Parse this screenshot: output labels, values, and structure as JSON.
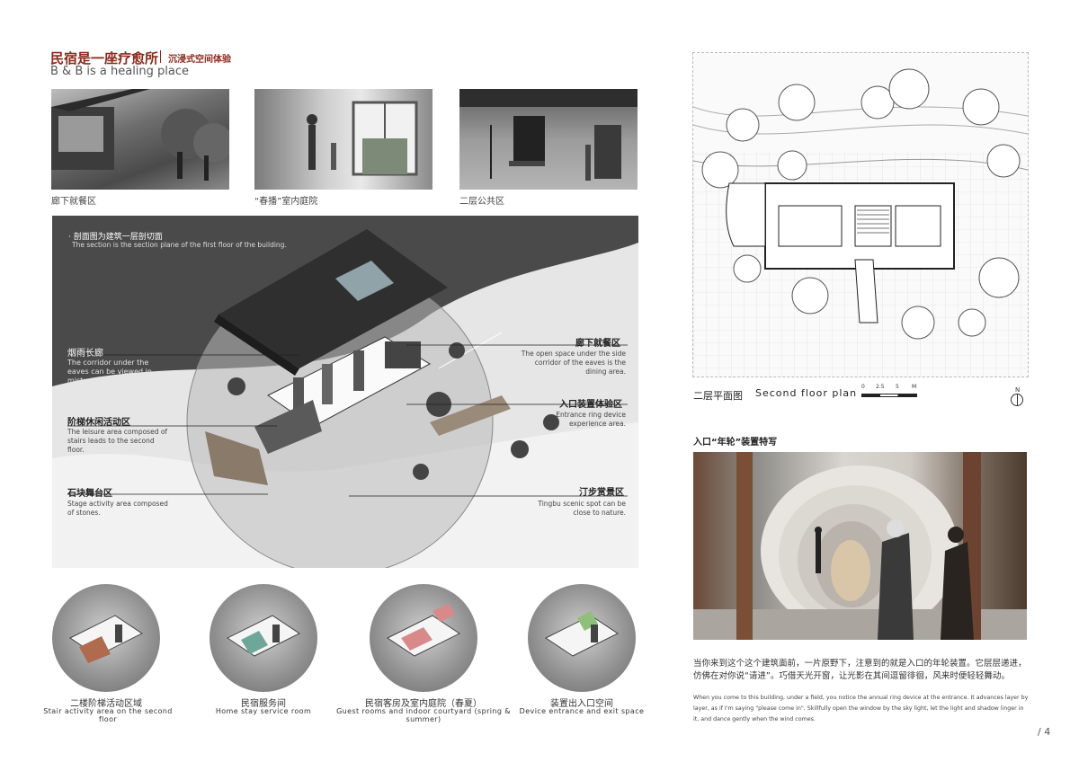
{
  "header": {
    "title_zh": "民宿是一座疗愈所",
    "subtitle_zh": "沉浸式空间体验",
    "title_en": "B & B is a healing place"
  },
  "photos": [
    {
      "caption": "廊下就餐区"
    },
    {
      "caption": "“春播”室内庭院"
    },
    {
      "caption": "二层公共区"
    }
  ],
  "section": {
    "note_zh": "· 剖面图为建筑一层剖切面",
    "note_en": "The section is the section plane of the first floor of the building.",
    "labels": {
      "mist_zh": "烟雨长廊",
      "mist_en": "The corridor under the eaves can be viewed in misty and rainy weather.",
      "dining_zh": "廊下就餐区",
      "dining_en": "The open space under the side corridor of the eaves is the dining area.",
      "stairs_zh": "阶梯休闲活动区",
      "stairs_en": "The leisure area composed of stairs leads to the second floor.",
      "entrance_zh": "入口装置体验区",
      "entrance_en": "Entrance ring device experience area.",
      "stage_zh": "石块舞台区",
      "stage_en": "Stage activity area composed of stones.",
      "tingbu_zh": "汀步赏景区",
      "tingbu_en": "Tingbu scenic spot can be close to nature."
    }
  },
  "circles": [
    {
      "zh": "二楼阶梯活动区域",
      "en": "Stair activity area on the second floor",
      "accent": "#b06a4e"
    },
    {
      "zh": "民宿服务间",
      "en": "Home stay service room",
      "accent": "#6fa69a"
    },
    {
      "zh": "民宿客房及室内庭院（春夏）",
      "en": "Guest rooms and indoor courtyard (spring & summer)",
      "accent": "#d88a8a"
    },
    {
      "zh": "装置出入口空间",
      "en": "Device entrance and exit space",
      "accent": "#8fbf7a"
    }
  ],
  "plan": {
    "title_zh": "二层平面图",
    "title_en": "Second floor plan",
    "scale": [
      "0",
      "2.5",
      "5",
      "M"
    ],
    "north": "N"
  },
  "render": {
    "title": "入口“年轮”装置特写",
    "text_zh": "当你来到这个这个建筑面前，一片原野下，注意到的就是入口的年轮装置。它层层递进，仿佛在对你说“请进”。巧借天光开窗，让光影在其间逗留徘徊，风来时便轻轻舞动。",
    "text_en": "When you come to this building, under a field, you notice the annual ring device at the entrance. It advances layer by layer, as if I'm saying \"please come in\". Skillfully open the window by the sky light, let the light and shadow linger in it, and dance gently when the wind comes."
  },
  "page_number": "/ 4"
}
